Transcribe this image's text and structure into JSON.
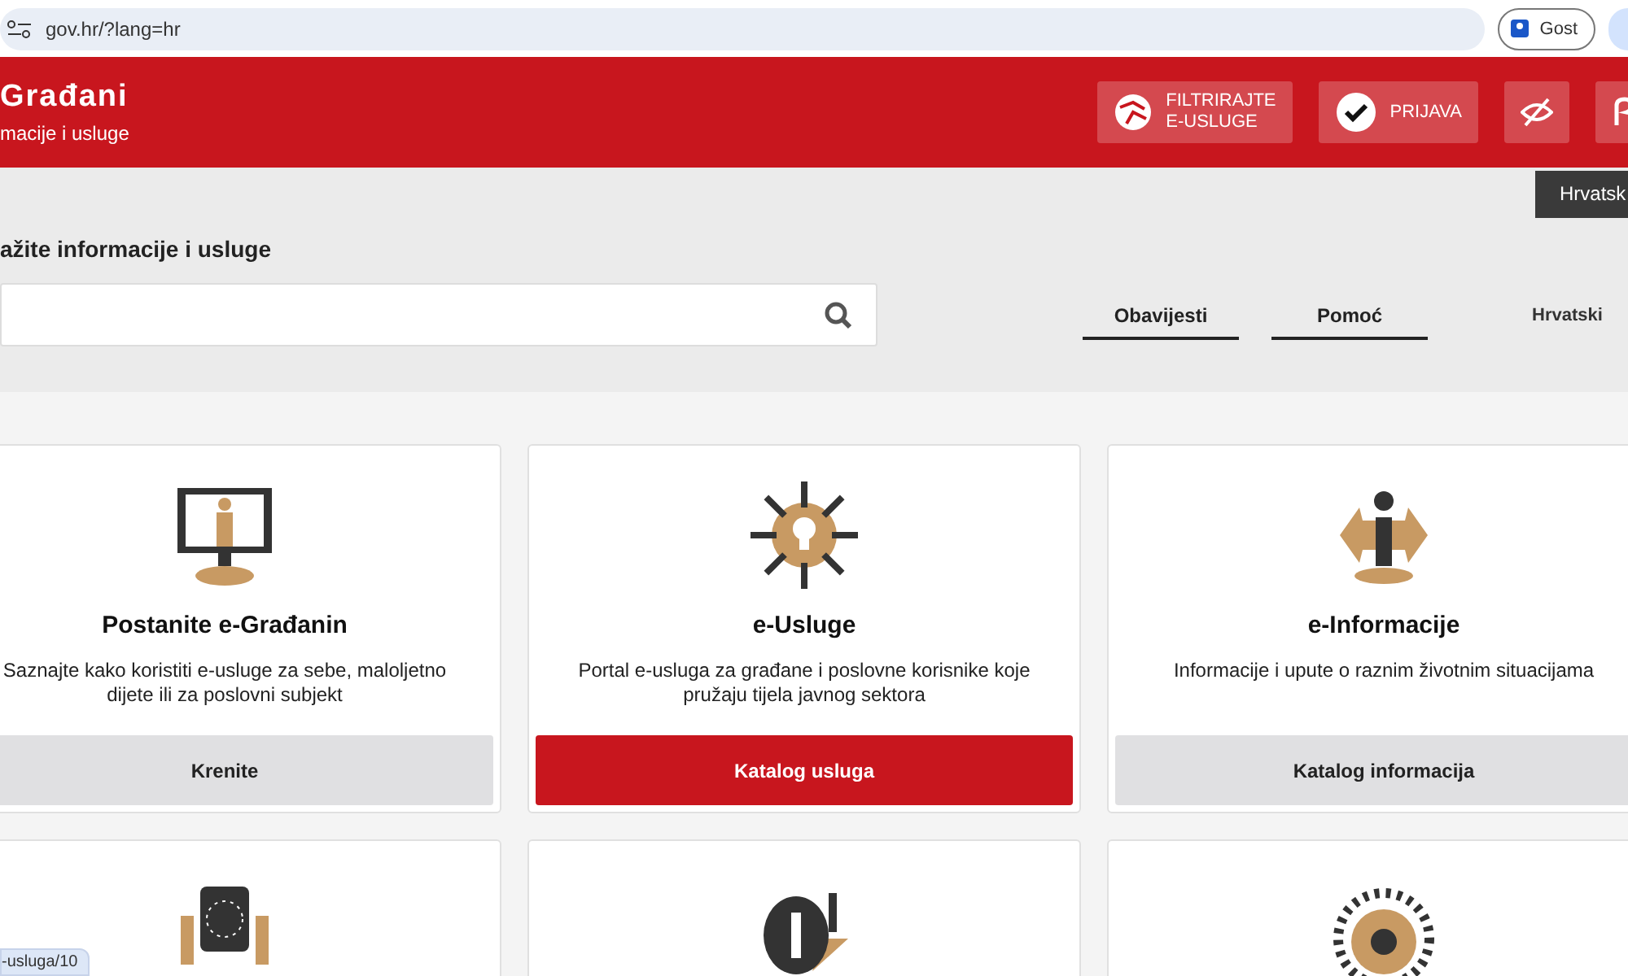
{
  "browser": {
    "url": "gov.hr/?lang=hr",
    "profile": "Gost"
  },
  "header": {
    "title": "Građani",
    "subtitle": "macije i usluge",
    "filter_button": [
      "FILTRIRAJTE",
      "E-USLUGE"
    ],
    "login_button": "PRIJAVA"
  },
  "language_tooltip": "Hrvatsk",
  "search": {
    "label": "ažite informacije i usluge"
  },
  "links": [
    {
      "label": "Obavijesti"
    },
    {
      "label": "Pomoć"
    }
  ],
  "language": "Hrvatski",
  "cards": [
    {
      "kind": "monitor",
      "title": "Postanite e-Građanin",
      "text": "Saznajte kako koristiti e-usluge za sebe, maloljetno dijete ili za poslovni subjekt",
      "button": "Krenite",
      "primary": false
    },
    {
      "kind": "star",
      "title": "e-Usluge",
      "text": "Portal e-usluga za građane i poslovne korisnike koje pružaju tijela javnog sektora",
      "button": "Katalog usluga",
      "primary": true
    },
    {
      "kind": "info",
      "title": "e-Informacije",
      "text": "Informacije i upute o raznim životnim situacijama",
      "button": "Katalog informacija",
      "primary": false
    },
    {
      "kind": "eu"
    },
    {
      "kind": "people"
    },
    {
      "kind": "circle"
    }
  ],
  "status_link": "-usluga/10"
}
